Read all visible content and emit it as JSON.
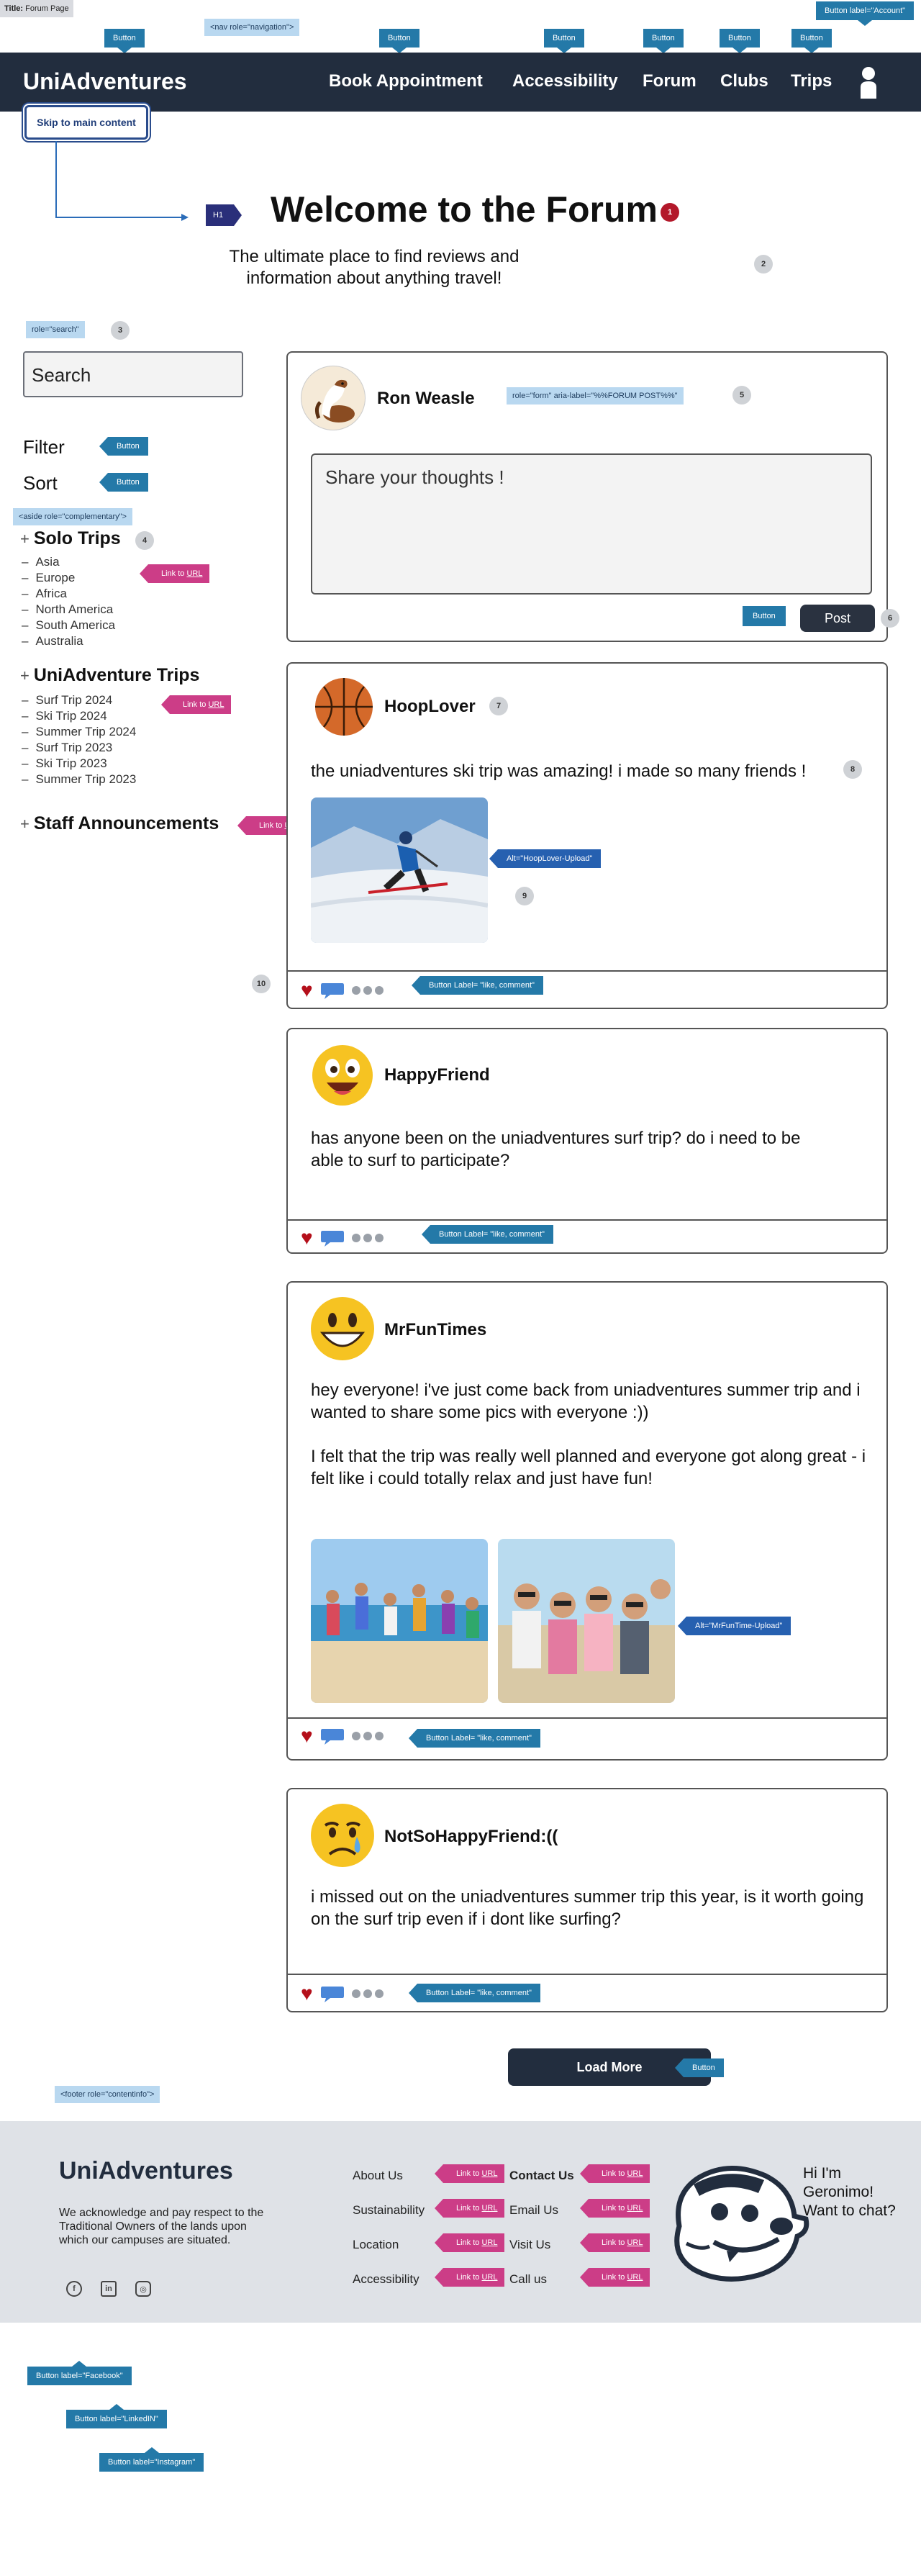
{
  "annotations": {
    "title_label": "Title:",
    "title_value": "Forum Page",
    "nav_role": "<nav role=\"navigation\">",
    "button": "Button",
    "account_button": "Button label=\"Account\"",
    "h1": "H1",
    "search_role": "role=\"search\"",
    "aside_role": "<aside role=\"complementary\">",
    "form_role": "role=\"form\" aria-label=\"%%FORUM POST%%\"",
    "link_prefix": "Link to ",
    "link_url": "URL",
    "alt_hooplover": "Alt=\"HoopLover-Upload\"",
    "alt_mrfuntime": "Alt=\"MrFunTime-Upload\"",
    "like_comment": "Button Label= \"like, comment\"",
    "footer_role": "<footer role=\"contentinfo\">",
    "btn_facebook": "Button label=\"Facebook\"",
    "btn_linkedin": "Button label=\"LinkedIN\"",
    "btn_instagram": "Button label=\"Instagram\"",
    "numbers": [
      "1",
      "2",
      "3",
      "4",
      "5",
      "6",
      "7",
      "8",
      "9",
      "10"
    ]
  },
  "header": {
    "logo": "UniAdventures",
    "nav": [
      "Book Appointment",
      "Accessibility",
      "Forum",
      "Clubs",
      "Trips"
    ],
    "skip_link": "Skip to main content"
  },
  "hero": {
    "title": "Welcome to the Forum",
    "subtitle": "The ultimate place to find reviews and information about anything travel!"
  },
  "sidebar": {
    "search_placeholder": "Search",
    "filter": "Filter",
    "sort": "Sort",
    "solo_title": "Solo Trips",
    "solo_items": [
      "Asia",
      "Europe",
      "Africa",
      "North America",
      "South America",
      "Australia"
    ],
    "trips_title": "UniAdventure Trips",
    "trips_items": [
      "Surf Trip 2024",
      "Ski Trip 2024",
      "Summer Trip 2024",
      "Surf Trip 2023",
      "Ski Trip 2023",
      "Summer Trip 2023"
    ],
    "staff_title": "Staff Announcements"
  },
  "composer": {
    "user": "Ron Weasle",
    "placeholder": "Share your thoughts !",
    "post": "Post"
  },
  "posts": [
    {
      "author": "HoopLover",
      "text": "the uniadventures ski trip was amazing! i made so many friends !"
    },
    {
      "author": "HappyFriend",
      "text": "has anyone been on the uniadventures surf trip? do i need to be able to surf to participate?"
    },
    {
      "author": "MrFunTimes",
      "text": "hey everyone! i've just come back from uniadventures summer trip and i wanted to share some pics with everyone :))",
      "text2": "I felt that the trip was really well planned and everyone got along great - i felt like i could totally relax and just have fun!"
    },
    {
      "author": "NotSoHappyFriend:((",
      "text": "i missed out on the uniadventures summer trip this year, is it worth going on the surf trip even if i dont like surfing?"
    }
  ],
  "load_more": "Load More",
  "footer": {
    "logo": "UniAdventures",
    "acknowledgement": "We acknowledge and pay respect to the Traditional Owners of the lands upon which our campuses are situated.",
    "col1": [
      "About Us",
      "Sustainability",
      "Location",
      "Accessibility"
    ],
    "col2": [
      "Contact Us",
      "Email Us",
      "Visit Us",
      "Call us"
    ],
    "chat": "Hi I'm Geronimo! Want to chat?"
  },
  "colors": {
    "navy": "#222d3e",
    "button_tag": "#2479a8",
    "link_tag": "#cc3d87",
    "alt_tag": "#2660b0",
    "role_tag": "#b9d8f0",
    "heart": "#b40f1a"
  }
}
